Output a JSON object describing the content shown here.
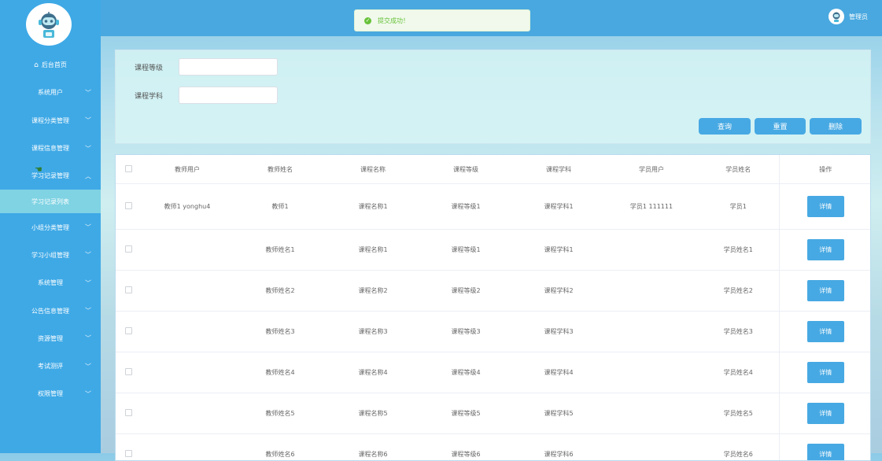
{
  "topbar": {
    "toast_text": "提交成功！",
    "user_name": "管理员"
  },
  "sidebar": {
    "items": [
      {
        "label": "后台首页",
        "has_home_icon": true
      },
      {
        "label": "系统用户"
      },
      {
        "label": "课程分类管理"
      },
      {
        "label": "课程信息管理"
      },
      {
        "label": "学习记录管理",
        "expanded": true
      },
      {
        "label": "学习记录列表",
        "active": true
      },
      {
        "label": "小组分类管理"
      },
      {
        "label": "学习小组管理"
      },
      {
        "label": "系统管理"
      },
      {
        "label": "公告信息管理"
      },
      {
        "label": "资源管理"
      },
      {
        "label": "考试测评"
      },
      {
        "label": "权限管理"
      }
    ]
  },
  "search": {
    "level_label": "课程等级",
    "level_value": "",
    "subject_label": "课程学科",
    "subject_value": "",
    "query_label": "查询",
    "reset_label": "重置",
    "delete_label": "删除"
  },
  "table": {
    "headers": [
      "教师用户",
      "教师姓名",
      "课程名称",
      "课程等级",
      "课程学科",
      "学员用户",
      "学员姓名",
      "操作"
    ],
    "detail_label": "详情",
    "rows": [
      [
        "教师1 yonghu4",
        "教师1",
        "课程名称1",
        "课程等级1",
        "课程学科1",
        "学员1 111111",
        "学员1"
      ],
      [
        "",
        "教师姓名1",
        "课程名称1",
        "课程等级1",
        "课程学科1",
        "",
        "学员姓名1"
      ],
      [
        "",
        "教师姓名2",
        "课程名称2",
        "课程等级2",
        "课程学科2",
        "",
        "学员姓名2"
      ],
      [
        "",
        "教师姓名3",
        "课程名称3",
        "课程等级3",
        "课程学科3",
        "",
        "学员姓名3"
      ],
      [
        "",
        "教师姓名4",
        "课程名称4",
        "课程等级4",
        "课程学科4",
        "",
        "学员姓名4"
      ],
      [
        "",
        "教师姓名5",
        "课程名称5",
        "课程等级5",
        "课程学科5",
        "",
        "学员姓名5"
      ],
      [
        "",
        "教师姓名6",
        "课程名称6",
        "课程等级6",
        "课程学科6",
        "",
        "学员姓名6"
      ]
    ]
  },
  "colors": {
    "sidebar": "#3fa9e6",
    "accent": "#47a9e3",
    "success": "#67c23a"
  }
}
